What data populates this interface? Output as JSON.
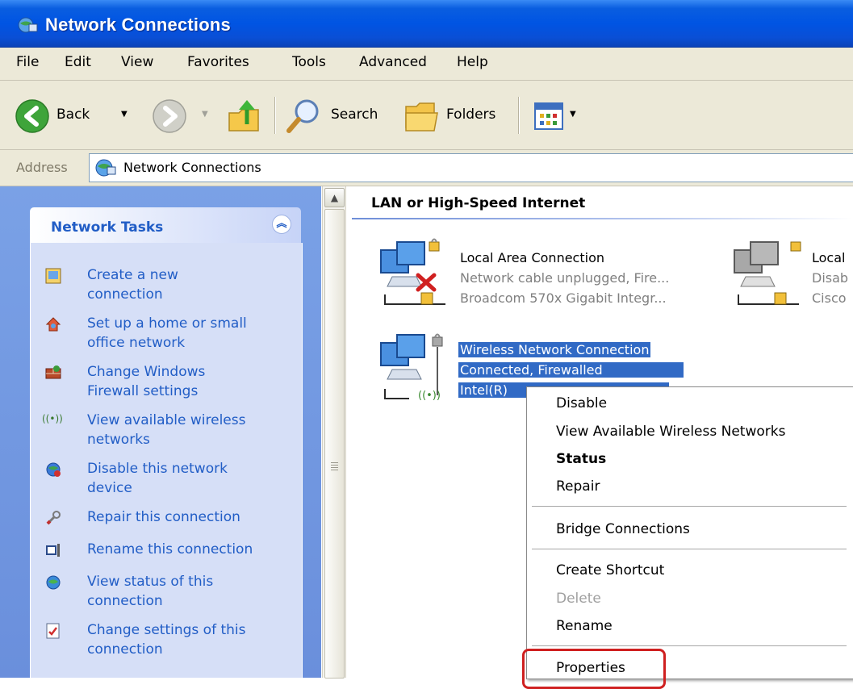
{
  "window": {
    "title": "Network Connections"
  },
  "menubar": [
    "File",
    "Edit",
    "View",
    "Favorites",
    "Tools",
    "Advanced",
    "Help"
  ],
  "toolbar": {
    "back": "Back",
    "search": "Search",
    "folders": "Folders"
  },
  "address": {
    "label": "Address",
    "value": "Network Connections"
  },
  "tasks": {
    "title": "Network Tasks",
    "items": [
      {
        "label": "Create a new\nconnection",
        "icon": "new-connection-icon"
      },
      {
        "label": "Set up a home or small\noffice network",
        "icon": "home-network-icon"
      },
      {
        "label": "Change Windows\nFirewall settings",
        "icon": "firewall-icon"
      },
      {
        "label": "View available wireless\nnetworks",
        "icon": "wireless-icon"
      },
      {
        "label": "Disable this network\ndevice",
        "icon": "disable-device-icon"
      },
      {
        "label": "Repair this connection",
        "icon": "repair-icon"
      },
      {
        "label": "Rename this connection",
        "icon": "rename-icon"
      },
      {
        "label": "View status of this\nconnection",
        "icon": "status-icon"
      },
      {
        "label": "Change settings of this\nconnection",
        "icon": "settings-icon"
      }
    ]
  },
  "main": {
    "group": "LAN or High-Speed Internet",
    "connections": [
      {
        "name": "Local Area Connection",
        "status": "Network cable unplugged, Fire...",
        "device": "Broadcom 570x Gigabit Integr..."
      },
      {
        "name": "Local",
        "status": "Disab",
        "device": "Cisco"
      },
      {
        "name": "Wireless Network Connection",
        "status": "Connected, Firewalled",
        "device": "Intel(R)"
      }
    ]
  },
  "context_menu": {
    "items": [
      "Disable",
      "View Available Wireless Networks",
      "Status",
      "Repair",
      "Bridge Connections",
      "Create Shortcut",
      "Delete",
      "Rename",
      "Properties"
    ]
  }
}
